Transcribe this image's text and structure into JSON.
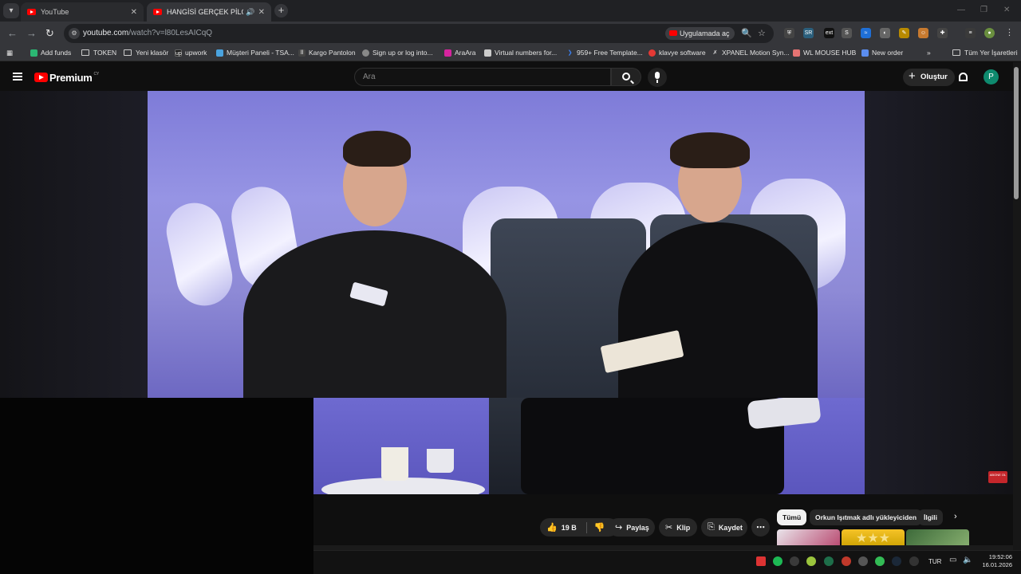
{
  "browser": {
    "tabs": [
      {
        "title": "YouTube",
        "active": false
      },
      {
        "title": "HANGİSİ GERÇEK PİLOT?! ft",
        "active": true
      }
    ],
    "url": {
      "host": "youtube.com",
      "path": "/watch?v=l80LesAICqQ"
    },
    "open_in_app": "Uygulamada aç",
    "bookmarks": [
      {
        "label": "Add funds",
        "icon": "leaf-icon",
        "color": "#2bb673"
      },
      {
        "label": "TOKEN",
        "icon": "folder-icon"
      },
      {
        "label": "Yeni klasör",
        "icon": "folder-icon"
      },
      {
        "label": "upwork",
        "icon": "upwork-icon",
        "color": "#14a800"
      },
      {
        "label": "Müşteri Paneli - TSA...",
        "icon": "bird-icon",
        "color": "#4aa3df"
      },
      {
        "label": "Kargo Pantolon",
        "icon": "bag-icon",
        "color": "#666666"
      },
      {
        "label": "Sign up or log into...",
        "icon": "globe-icon",
        "color": "#888888"
      },
      {
        "label": "AraAra",
        "icon": "instagram-icon",
        "color": "#d6249f"
      },
      {
        "label": "Virtual numbers for...",
        "icon": "phone-icon",
        "color": "#cccccc"
      },
      {
        "label": "959+ Free Template...",
        "icon": "arrow-icon",
        "color": "#3b82f6"
      },
      {
        "label": "klavye software",
        "icon": "keyboard-icon",
        "color": "#e53935"
      },
      {
        "label": "XPANEL Motion Syn...",
        "icon": "x-icon",
        "color": "#dddddd"
      },
      {
        "label": "WL MOUSE HUB",
        "icon": "mouse-icon",
        "color": "#e57373"
      },
      {
        "label": "New order",
        "icon": "cart-icon",
        "color": "#5b8def"
      }
    ],
    "all_bookmarks": "Tüm Yer İşaretleri"
  },
  "youtube": {
    "brand": "Premium",
    "brand_region": "CY",
    "search_placeholder": "Ara",
    "create_label": "Oluştur",
    "avatar_letter": "P",
    "actions": {
      "like_count": "19 B",
      "share": "Paylaş",
      "clip": "Klip",
      "save": "Kaydet"
    },
    "filter_chips": [
      "Tümü",
      "Orkun Işıtmak adlı yükleyiciden",
      "İlgili"
    ],
    "subscribe_badge": "ABONE OL"
  },
  "taskbar": {
    "language": "TUR",
    "time": "19:52:06",
    "date": "16.01.2026"
  },
  "colors": {
    "accent_red": "#ff0000",
    "avatar_bg": "#0e8a6e",
    "video_bg": "#8e8ad6"
  }
}
